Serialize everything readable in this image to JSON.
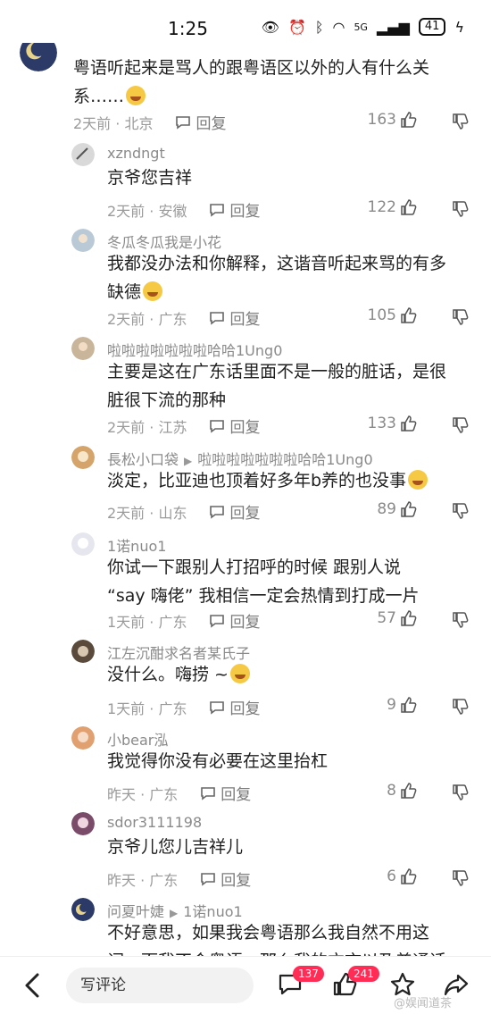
{
  "status_bar": {
    "time": "1:25",
    "signal": "5G",
    "battery": "41"
  },
  "comments": [
    {
      "name": "",
      "text_lines": [
        "粤语听起来是骂人的跟粤语区以外的人有什么关",
        "系……"
      ],
      "time_location": "2天前 · 北京",
      "reply": "回复",
      "likes": "163"
    },
    {
      "name": "xzndngt",
      "text_lines": [
        "京爷您吉祥"
      ],
      "time_location": "2天前 · 安徽",
      "reply": "回复",
      "likes": "122"
    },
    {
      "name": "冬瓜冬瓜我是小花",
      "text_lines": [
        "我都没办法和你解释，这谐音听起来骂的有多",
        "缺德"
      ],
      "time_location": "2天前 · 广东",
      "reply": "回复",
      "likes": "105"
    },
    {
      "name": "啦啦啦啦啦啦啦哈哈1Ung0",
      "text_lines": [
        "主要是这在广东话里面不是一般的脏话，是很",
        "脏很下流的那种"
      ],
      "time_location": "2天前 · 江苏",
      "reply": "回复",
      "likes": "133"
    },
    {
      "name": "長松小口袋",
      "reply_to": "啦啦啦啦啦啦啦哈哈1Ung0",
      "text_lines": [
        "淡定，比亚迪也顶着好多年b养的也没事"
      ],
      "time_location": "2天前 · 山东",
      "reply": "回复",
      "likes": "89"
    },
    {
      "name": "1诺nuo1",
      "text_lines": [
        "你试一下跟别人打招呼的时候 跟别人说",
        "“say 嗨佬” 我相信一定会热情到打成一片"
      ],
      "time_location": "1天前 · 广东",
      "reply": "回复",
      "likes": "57"
    },
    {
      "name": "江左沉酣求名者某氏子",
      "text_lines": [
        "没什么。嗨捞 ~"
      ],
      "time_location": "1天前 · 广东",
      "reply": "回复",
      "likes": "9"
    },
    {
      "name": "小bear泓",
      "text_lines": [
        "我觉得你没有必要在这里抬杠"
      ],
      "time_location": "昨天 · 广东",
      "reply": "回复",
      "likes": "8"
    },
    {
      "name": "sdor3111198",
      "text_lines": [
        "京爷儿您儿吉祥儿"
      ],
      "time_location": "昨天 · 广东",
      "reply": "回复",
      "likes": "6"
    },
    {
      "name": "问夏叶婕",
      "reply_to": "1诺nuo1",
      "text_lines": [
        "不好意思，如果我会粤语那么我自然不用这",
        "词，而我不会粤语，那么我的方言以及普通话"
      ],
      "time_location": "",
      "reply": "",
      "likes": ""
    }
  ],
  "bottom_bar": {
    "input_placeholder": "写评论",
    "comment_count": "137",
    "like_count": "241",
    "watermark": "@娱闻道茶"
  }
}
